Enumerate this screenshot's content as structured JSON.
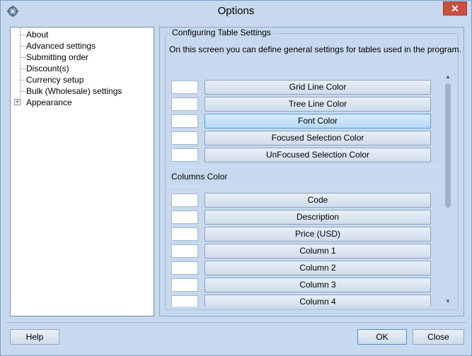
{
  "window": {
    "title": "Options",
    "close_glyph": "✕",
    "icon": "settings-icon"
  },
  "tree": {
    "items": [
      {
        "label": "About",
        "expander": ""
      },
      {
        "label": "Advanced settings",
        "expander": ""
      },
      {
        "label": "Submitting order",
        "expander": ""
      },
      {
        "label": "Discount(s)",
        "expander": ""
      },
      {
        "label": "Currency setup",
        "expander": ""
      },
      {
        "label": "Bulk (Wholesale) settings",
        "expander": ""
      },
      {
        "label": "Appearance",
        "expander": "+"
      }
    ]
  },
  "panel": {
    "group_title": "Configuring Table Settings",
    "description": "On this screen you can define general settings for tables used in the program.",
    "table_colors": [
      {
        "label": "Grid Line Color"
      },
      {
        "label": "Tree Line Color"
      },
      {
        "label": "Font Color",
        "active": true
      },
      {
        "label": "Focused Selection Color"
      },
      {
        "label": "UnFocused Selection Color"
      }
    ],
    "columns_section_label": "Columns Color",
    "column_colors": [
      {
        "label": "Code"
      },
      {
        "label": "Description"
      },
      {
        "label": "Price (USD)"
      },
      {
        "label": "Column 1"
      },
      {
        "label": "Column 2"
      },
      {
        "label": "Column 3"
      },
      {
        "label": "Column 4"
      }
    ],
    "scroll_up": "▲",
    "scroll_down": "▼"
  },
  "footer": {
    "help_label": "Help",
    "ok_label": "OK",
    "close_label": "Close"
  },
  "colors": {
    "window_bg": "#c7d9ee",
    "close_button": "#c7503f",
    "active_button": "#b6d8f5"
  }
}
